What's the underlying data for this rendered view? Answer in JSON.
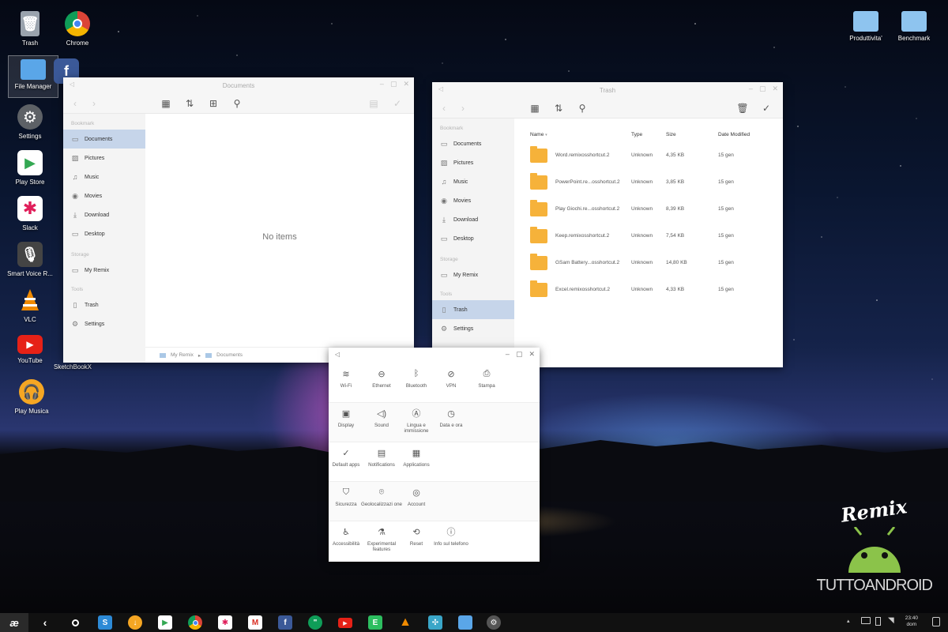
{
  "desktop": {
    "icons_left": [
      {
        "label": "Trash",
        "icon": "trash-icon",
        "color": "#9aa3ad"
      },
      {
        "label": "Chrome",
        "icon": "chrome-icon",
        "color": "#e44c3c"
      },
      {
        "label": "File Manager",
        "icon": "folder-icon",
        "color": "#5aa6e8"
      },
      {
        "label": "Settings",
        "icon": "gear-icon",
        "color": "#6b6f74"
      },
      {
        "label": "Play Store",
        "icon": "play-store-icon",
        "color": "#ffffff"
      },
      {
        "label": "Slack",
        "icon": "slack-icon",
        "color": "#ffffff"
      },
      {
        "label": "Smart Voice R...",
        "icon": "microphone-icon",
        "color": "#444444"
      },
      {
        "label": "VLC",
        "icon": "vlc-icon",
        "color": "#f08a00"
      },
      {
        "label": "YouTube",
        "icon": "youtube-icon",
        "color": "#e62117"
      },
      {
        "label": "Play Musica",
        "icon": "headphones-icon",
        "color": "#f5a623"
      },
      {
        "label": "SketchBookX",
        "icon": "sketchbook-icon",
        "color": "#2d8ad6"
      }
    ],
    "icons_right": [
      {
        "label": "Produttivita'",
        "icon": "folder-icon"
      },
      {
        "label": "Benchmark",
        "icon": "folder-icon"
      }
    ]
  },
  "documents_window": {
    "title": "Documents",
    "sidebar": {
      "bookmark_label": "Bookmark",
      "bookmarks": [
        "Documents",
        "Pictures",
        "Music",
        "Movies",
        "Download",
        "Desktop"
      ],
      "storage_label": "Storage",
      "storage": [
        "My Remix"
      ],
      "tools_label": "Tools",
      "tools": [
        "Trash",
        "Settings"
      ]
    },
    "empty_message": "No items",
    "path": [
      "My Remix",
      "Documents"
    ]
  },
  "trash_window": {
    "title": "Trash",
    "sidebar": {
      "bookmark_label": "Bookmark",
      "bookmarks": [
        "Documents",
        "Pictures",
        "Music",
        "Movies",
        "Download",
        "Desktop"
      ],
      "storage_label": "Storage",
      "storage": [
        "My Remix"
      ],
      "tools_label": "Tools",
      "tools": [
        "Trash",
        "Settings"
      ]
    },
    "columns": [
      "Name",
      "Type",
      "Size",
      "Date Modified"
    ],
    "files": [
      {
        "name": "Word.remixosshortcut.2",
        "type": "Unknown",
        "size": "4,35 KB",
        "date": "15 gen"
      },
      {
        "name": "PowerPoint.re...osshortcut.2",
        "type": "Unknown",
        "size": "3,85 KB",
        "date": "15 gen"
      },
      {
        "name": "Play Giochi.re...osshortcut.2",
        "type": "Unknown",
        "size": "8,39 KB",
        "date": "15 gen"
      },
      {
        "name": "Keep.remixosshortcut.2",
        "type": "Unknown",
        "size": "7,54 KB",
        "date": "15 gen"
      },
      {
        "name": "GSam Battery...osshortcut.2",
        "type": "Unknown",
        "size": "14,80 KB",
        "date": "15 gen"
      },
      {
        "name": "Excel.remixosshortcut.2",
        "type": "Unknown",
        "size": "4,33 KB",
        "date": "15 gen"
      }
    ]
  },
  "settings_window": {
    "rows": [
      [
        {
          "label": "Wi-Fi",
          "icon": "wifi-icon"
        },
        {
          "label": "Ethernet",
          "icon": "ethernet-icon"
        },
        {
          "label": "Bluetooth",
          "icon": "bluetooth-icon"
        },
        {
          "label": "VPN",
          "icon": "vpn-icon"
        },
        {
          "label": "Stampa",
          "icon": "printer-icon"
        }
      ],
      [
        {
          "label": "Display",
          "icon": "display-icon"
        },
        {
          "label": "Sound",
          "icon": "speaker-icon"
        },
        {
          "label": "Lingua e immissione",
          "icon": "language-icon"
        },
        {
          "label": "Data e ora",
          "icon": "clock-icon"
        }
      ],
      [
        {
          "label": "Default apps",
          "icon": "check-circle-icon"
        },
        {
          "label": "Notifications",
          "icon": "notification-icon"
        },
        {
          "label": "Applications",
          "icon": "apps-grid-icon"
        }
      ],
      [
        {
          "label": "Sicurezza",
          "icon": "shield-icon"
        },
        {
          "label": "Geolocalizzazi one",
          "icon": "location-pin-icon"
        },
        {
          "label": "Account",
          "icon": "account-icon"
        }
      ],
      [
        {
          "label": "Accessibilità",
          "icon": "accessibility-icon"
        },
        {
          "label": "Experimental features",
          "icon": "flask-icon"
        },
        {
          "label": "Reset",
          "icon": "reset-icon"
        },
        {
          "label": "Info sul telefono",
          "icon": "info-icon"
        }
      ]
    ]
  },
  "taskbar": {
    "start_label": "Remix",
    "apps": [
      "sketchbook-icon",
      "download-icon",
      "play-store-icon",
      "chrome-icon",
      "slack-icon",
      "gmail-icon",
      "facebook-icon",
      "hangouts-icon",
      "youtube-icon",
      "evernote-icon",
      "vlc-icon",
      "app-icon",
      "folder-icon",
      "gear-icon"
    ],
    "time": "23:40",
    "day": "dom"
  },
  "watermark": {
    "remix": "Remix",
    "brand": "TUTTOANDROID"
  }
}
